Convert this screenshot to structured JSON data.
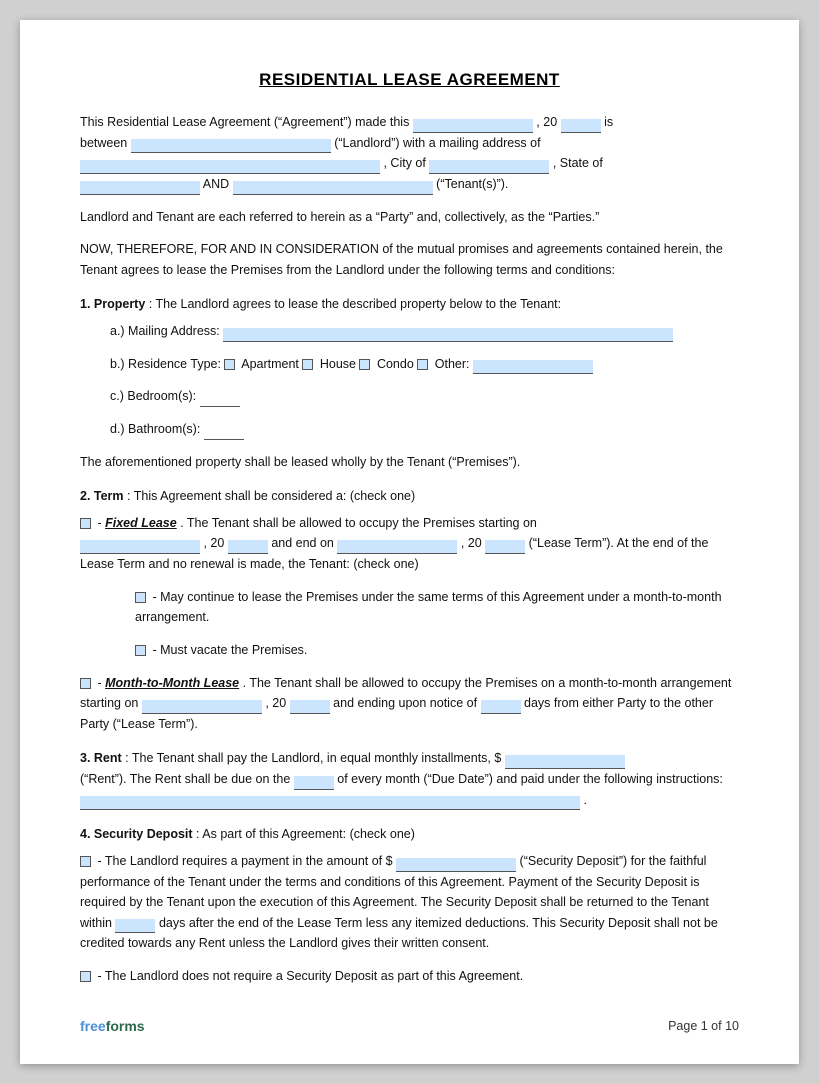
{
  "title": "RESIDENTIAL LEASE AGREEMENT",
  "intro": {
    "line1a": "This Residential Lease Agreement (“Agreement”) made this",
    "line1b": ", 20",
    "line1c": "is",
    "line2a": "between",
    "line2b": "(“Landlord”) with a mailing address of",
    "line3a": ", City of",
    "line3b": ", State of",
    "line4a": "AND",
    "line4b": "(“Tenant(s)”)."
  },
  "parties_line": "Landlord and Tenant are each referred to herein as a “Party” and, collectively, as the “Parties.”",
  "consideration": "NOW, THEREFORE, FOR AND IN CONSIDERATION of the mutual promises and agreements contained herein, the Tenant agrees to lease the Premises from the Landlord under the following terms and conditions:",
  "section1": {
    "header": "1. Property",
    "text": ": The Landlord agrees to lease the described property below to the Tenant:",
    "a_label": "a.)  Mailing Address:",
    "b_label": "b.)  Residence Type:",
    "b_options": [
      "Apartment",
      "House",
      "Condo",
      "Other:"
    ],
    "c_label": "c.)  Bedroom(s):",
    "d_label": "d.)  Bathroom(s):",
    "closing": "The aforementioned property shall be leased wholly by the Tenant (“Premises”)."
  },
  "section2": {
    "header": "2. Term",
    "text": ": This Agreement shall be considered a: (check one)",
    "fixed_label": "Fixed Lease",
    "fixed_text1": ". The Tenant shall be allowed to occupy the Premises starting on",
    "fixed_text2": ", 20",
    "fixed_text3": "and end on",
    "fixed_text4": ", 20",
    "fixed_text5": "(“Lease Term”). At the end of the Lease Term and no renewal is made, the Tenant: (check one)",
    "option1": "- May continue to lease the Premises under the same terms of this Agreement under a month-to-month arrangement.",
    "option2": "- Must vacate the Premises.",
    "month_label": "Month-to-Month Lease",
    "month_text1": ". The Tenant shall be allowed to occupy the Premises on a month-to-month arrangement starting on",
    "month_text2": ", 20",
    "month_text3": "and ending upon notice of",
    "month_text4": "days from either Party to the other Party (“Lease Term”)."
  },
  "section3": {
    "header": "3. Rent",
    "text1": ": The Tenant shall pay the Landlord, in equal monthly installments, $",
    "text2": "(“Rent”). The Rent shall be due on the",
    "text3": "of every month (“Due Date”) and paid under the following instructions:",
    "text4": "."
  },
  "section4": {
    "header": "4. Security Deposit",
    "text": ": As part of this Agreement: (check one)",
    "option1_text1": "- The Landlord requires a payment in the amount of $",
    "option1_text2": "(“Security Deposit”) for the faithful performance of the Tenant under the terms and conditions of this Agreement. Payment of the Security Deposit is required by the Tenant upon the execution of this Agreement. The Security Deposit shall be returned to the Tenant within",
    "option1_text3": "days after the end of the Lease Term less any itemized deductions. This Security Deposit shall not be credited towards any Rent unless the Landlord gives their written consent.",
    "option2_text": "- The Landlord does not require a Security Deposit as part of this Agreement."
  },
  "footer": {
    "brand_free": "free",
    "brand_forms": "forms",
    "page": "Page 1 of 10"
  }
}
